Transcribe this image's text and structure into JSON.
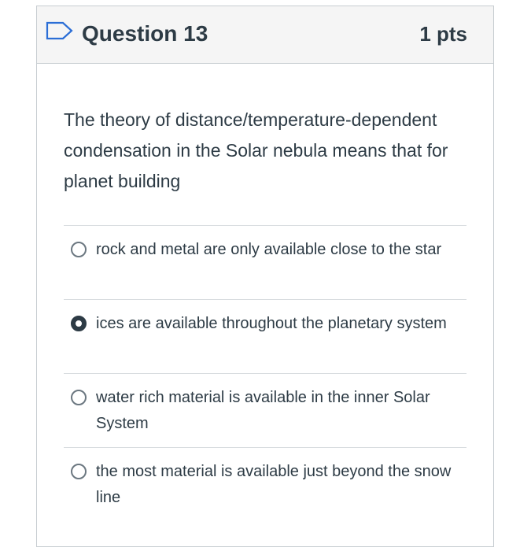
{
  "question": {
    "title": "Question 13",
    "points": "1 pts",
    "text": "The theory of distance/temperature-dependent condensation in the Solar nebula means that for planet building",
    "answers": [
      {
        "label": "rock and metal are only available close to the star",
        "selected": false
      },
      {
        "label": "ices are available throughout the planetary system",
        "selected": true
      },
      {
        "label": "water rich material is available in the inner Solar System",
        "selected": false
      },
      {
        "label": "the most material is available just beyond the snow line",
        "selected": false
      }
    ]
  },
  "colors": {
    "header_bg": "#f5f5f5",
    "border": "#c7cdd1",
    "text": "#2d3b45",
    "flag_icon": "#2b6ed6"
  },
  "icons": {
    "flag": "flag-question-icon"
  }
}
